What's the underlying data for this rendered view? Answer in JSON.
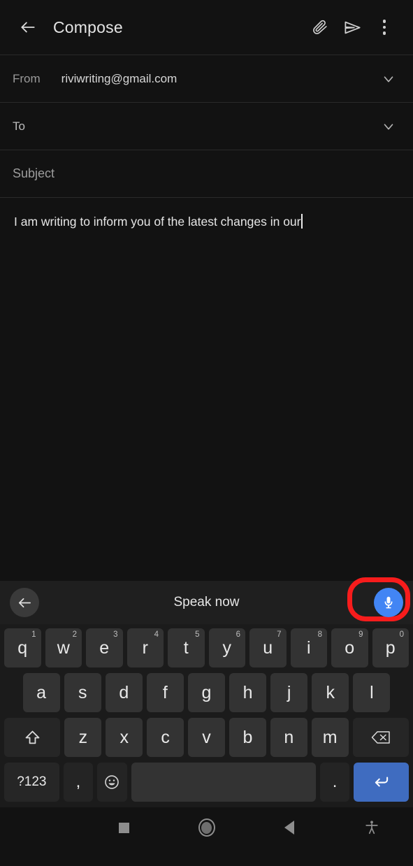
{
  "appbar": {
    "back_icon": "arrow-left-icon",
    "title": "Compose",
    "attach_icon": "paperclip-icon",
    "send_icon": "send-icon",
    "overflow_icon": "more-vertical-icon"
  },
  "fields": {
    "from_label": "From",
    "from_value": "riviwriting@gmail.com",
    "from_chevron_icon": "chevron-down-icon",
    "to_label": "To",
    "to_value": "",
    "to_chevron_icon": "chevron-down-icon",
    "subject_label": "Subject",
    "subject_value": ""
  },
  "body": {
    "text": "I am writing to inform you of the latest changes in our",
    "caret_visible": true
  },
  "voice": {
    "back_icon": "arrow-left-icon",
    "prompt": "Speak now",
    "mic_icon": "microphone-icon",
    "mic_color": "#4285F4",
    "highlight_color": "#f71c1c"
  },
  "keyboard": {
    "row1": [
      {
        "label": "q",
        "sup": "1"
      },
      {
        "label": "w",
        "sup": "2"
      },
      {
        "label": "e",
        "sup": "3"
      },
      {
        "label": "r",
        "sup": "4"
      },
      {
        "label": "t",
        "sup": "5"
      },
      {
        "label": "y",
        "sup": "6"
      },
      {
        "label": "u",
        "sup": "7"
      },
      {
        "label": "i",
        "sup": "8"
      },
      {
        "label": "o",
        "sup": "9"
      },
      {
        "label": "p",
        "sup": "0"
      }
    ],
    "row2": [
      {
        "label": "a"
      },
      {
        "label": "s"
      },
      {
        "label": "d"
      },
      {
        "label": "f"
      },
      {
        "label": "g"
      },
      {
        "label": "h"
      },
      {
        "label": "j"
      },
      {
        "label": "k"
      },
      {
        "label": "l"
      }
    ],
    "row3": {
      "shift_icon": "shift-icon",
      "letters": [
        {
          "label": "z"
        },
        {
          "label": "x"
        },
        {
          "label": "c"
        },
        {
          "label": "v"
        },
        {
          "label": "b"
        },
        {
          "label": "n"
        },
        {
          "label": "m"
        }
      ],
      "backspace_icon": "backspace-icon"
    },
    "row4": {
      "symbols_label": "?123",
      "comma_label": ",",
      "emoji_icon": "emoji-smiley-icon",
      "space_label": "",
      "period_label": ".",
      "enter_icon": "enter-key-icon",
      "enter_color": "#3F6CC0"
    }
  },
  "navbar": {
    "recents_icon": "square-recents-icon",
    "home_icon": "circle-home-icon",
    "back_icon": "triangle-back-icon",
    "accessibility_icon": "accessibility-icon"
  }
}
